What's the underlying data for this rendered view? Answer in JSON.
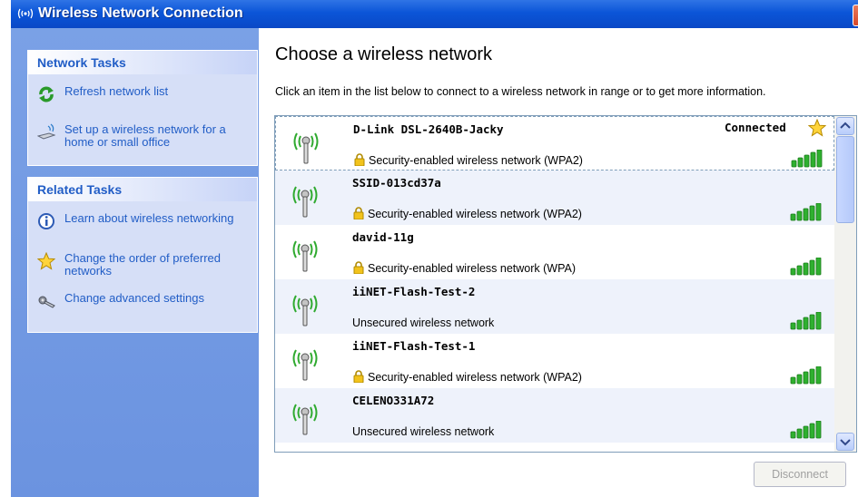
{
  "window": {
    "title": "Wireless Network Connection"
  },
  "sidebar": {
    "network_tasks": {
      "header": "Network Tasks",
      "items": [
        {
          "label": "Refresh network list",
          "icon": "refresh-icon"
        },
        {
          "label": "Set up a wireless network for a home or small office",
          "icon": "wireless-setup-icon"
        }
      ]
    },
    "related_tasks": {
      "header": "Related Tasks",
      "items": [
        {
          "label": "Learn about wireless networking",
          "icon": "info-icon"
        },
        {
          "label": "Change the order of preferred networks",
          "icon": "star-icon"
        },
        {
          "label": "Change advanced settings",
          "icon": "settings-icon"
        }
      ]
    }
  },
  "main": {
    "heading": "Choose a wireless network",
    "instructions": "Click an item in the list below to connect to a wireless network in range or to get more information.",
    "networks": [
      {
        "name": "D-Link DSL-2640B-Jacky",
        "status": "Connected",
        "security": "Security-enabled wireless network (WPA2)",
        "secured": true
      },
      {
        "name": "SSID-013cd37a",
        "status": "",
        "security": "Security-enabled wireless network (WPA2)",
        "secured": true
      },
      {
        "name": "david-11g",
        "status": "",
        "security": "Security-enabled wireless network (WPA)",
        "secured": true
      },
      {
        "name": "iiNET-Flash-Test-2",
        "status": "",
        "security": "Unsecured wireless network",
        "secured": false
      },
      {
        "name": "iiNET-Flash-Test-1",
        "status": "",
        "security": "Security-enabled wireless network (WPA2)",
        "secured": true
      },
      {
        "name": "CELENO331A72",
        "status": "",
        "security": "Unsecured wireless network",
        "secured": false
      }
    ],
    "disconnect_label": "Disconnect"
  },
  "colors": {
    "titlebar": "#0b55d8",
    "sidebar": "#6b93e0",
    "task_link": "#215dc6"
  }
}
